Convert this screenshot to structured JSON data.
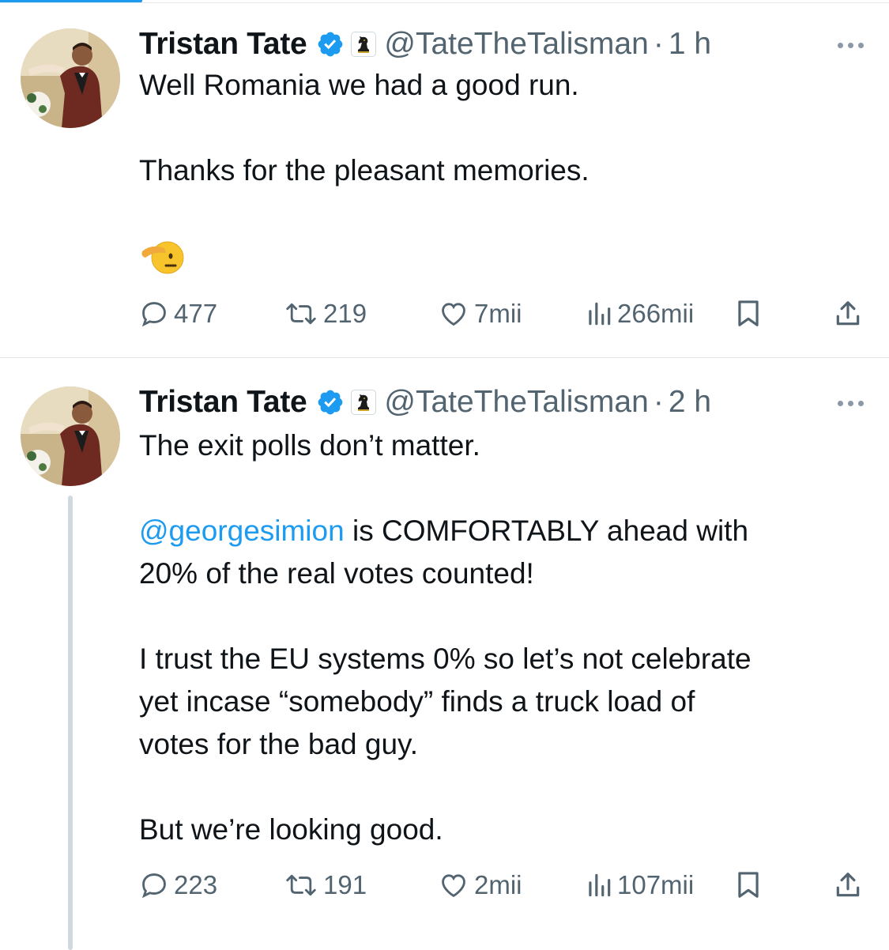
{
  "tweets": [
    {
      "author": {
        "name": "Tristan Tate",
        "handle": "@TateTheTalisman",
        "time": "1 h"
      },
      "text": {
        "p1": "Well Romania we had a good run.",
        "p2": "Thanks for the pleasant memories."
      },
      "emoji": "saluting-face",
      "stats": {
        "replies": "477",
        "reposts": "219",
        "likes": "7mii",
        "views": "266mii"
      }
    },
    {
      "author": {
        "name": "Tristan Tate",
        "handle": "@TateTheTalisman",
        "time": "2 h"
      },
      "text": {
        "p1": "The exit polls don’t matter.",
        "p2_mention": "@georgesimion",
        "p2_rest": " is COMFORTABLY ahead with",
        "p2_line2": "20% of the real votes counted!",
        "p3_line1": "I trust the EU systems 0% so let’s not celebrate",
        "p3_line2": "yet incase “somebody” finds a truck load of",
        "p3_line3": "votes for the bad guy.",
        "p4": "But we’re looking good."
      },
      "stats": {
        "replies": "223",
        "reposts": "191",
        "likes": "2mii",
        "views": "107mii"
      }
    }
  ],
  "colors": {
    "accent": "#1d9bf0",
    "secondary_text": "#536471",
    "primary_text": "#0f1419"
  },
  "icons": [
    "verified-badge-icon",
    "affiliate-knight-icon",
    "more-icon",
    "reply-icon",
    "repost-icon",
    "like-icon",
    "views-icon",
    "bookmark-icon",
    "share-icon"
  ]
}
